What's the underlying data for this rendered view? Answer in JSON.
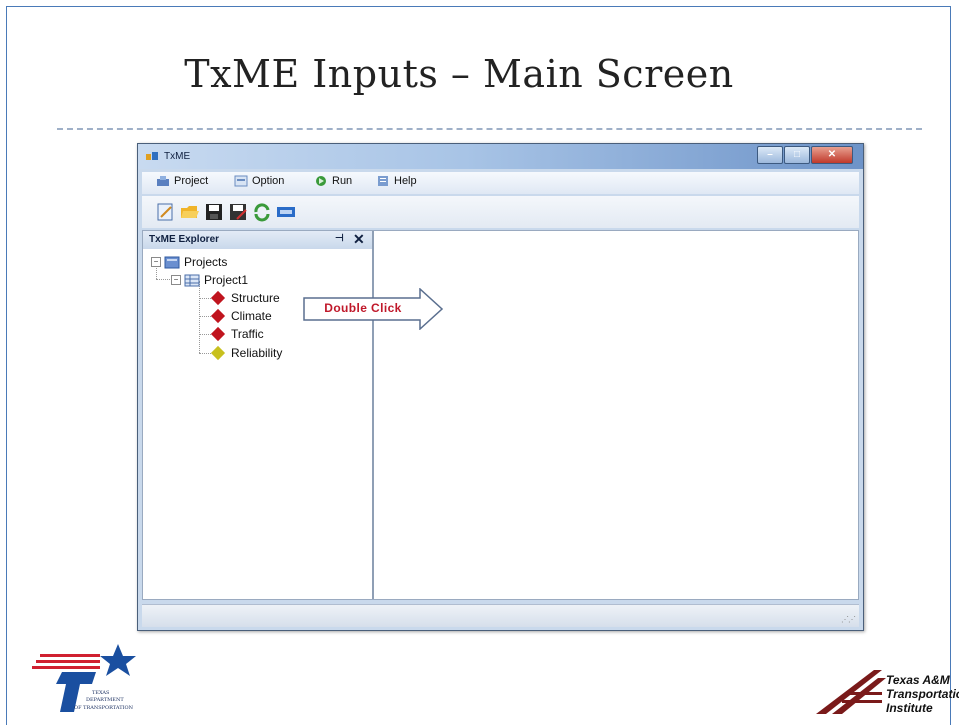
{
  "slide": {
    "title": "TxME Inputs – Main Screen"
  },
  "window": {
    "title": "TxME",
    "menu": [
      {
        "label": "Project",
        "icon": "project-icon"
      },
      {
        "label": "Option",
        "icon": "option-icon"
      },
      {
        "label": "Run",
        "icon": "run-icon"
      },
      {
        "label": "Help",
        "icon": "help-icon"
      }
    ],
    "toolbar": [
      "new-project-icon",
      "open-folder-icon",
      "save-icon",
      "save-as-icon",
      "refresh-icon",
      "exit-icon"
    ]
  },
  "explorer": {
    "title": "TxME Explorer",
    "pin_glyph": "⊣",
    "close_glyph": "✕",
    "tree": {
      "root": "Projects",
      "project": "Project1",
      "items": [
        {
          "label": "Structure",
          "color": "#c0141e"
        },
        {
          "label": "Climate",
          "color": "#c0141e"
        },
        {
          "label": "Traffic",
          "color": "#c0141e"
        },
        {
          "label": "Reliability",
          "color": "#c8c01e"
        }
      ]
    }
  },
  "callout": {
    "text": "Double Click"
  },
  "logos": {
    "txdot_text": [
      "TEXAS",
      "DEPARTMENT",
      "OF TRANSPORTATION"
    ],
    "tti_text": [
      "Texas A&M",
      "Transportation",
      "Institute"
    ]
  }
}
